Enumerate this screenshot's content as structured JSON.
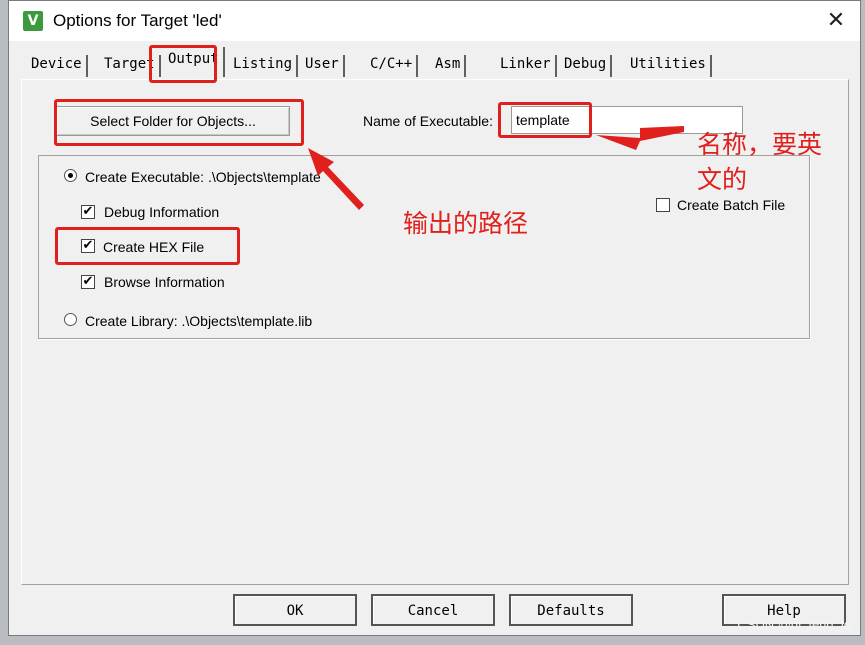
{
  "window": {
    "title": "Options for Target 'led'",
    "close_glyph": "✕",
    "app_icon": "V"
  },
  "tabs": [
    {
      "label": "Device"
    },
    {
      "label": "Target"
    },
    {
      "label": "Output"
    },
    {
      "label": "Listing"
    },
    {
      "label": "User"
    },
    {
      "label": "C/C++"
    },
    {
      "label": "Asm"
    },
    {
      "label": "Linker"
    },
    {
      "label": "Debug"
    },
    {
      "label": "Utilities"
    }
  ],
  "active_tab": "Output",
  "output": {
    "select_folder_label": "Select Folder for Objects...",
    "name_label": "Name of Executable:",
    "name_value": "template",
    "create_executable_label": "Create Executable:  .\\Objects\\template",
    "debug_info_label": "Debug Information",
    "create_hex_label": "Create HEX File",
    "browse_info_label": "Browse Information",
    "create_library_label": "Create Library:  .\\Objects\\template.lib",
    "create_batch_label": "Create Batch File",
    "checked": {
      "create_executable": true,
      "debug_info": true,
      "create_hex": true,
      "browse_info": true,
      "create_library": false,
      "create_batch": false
    },
    "check_glyph": "✔"
  },
  "annotations": {
    "name_note_line1": "名称，要英",
    "name_note_line2": "文的",
    "path_note": "输出的路径",
    "color": "#e0201c"
  },
  "footer": {
    "ok": "OK",
    "cancel": "Cancel",
    "defaults": "Defaults",
    "help": "Help"
  },
  "watermark": "CSDN @qi_feng_le"
}
